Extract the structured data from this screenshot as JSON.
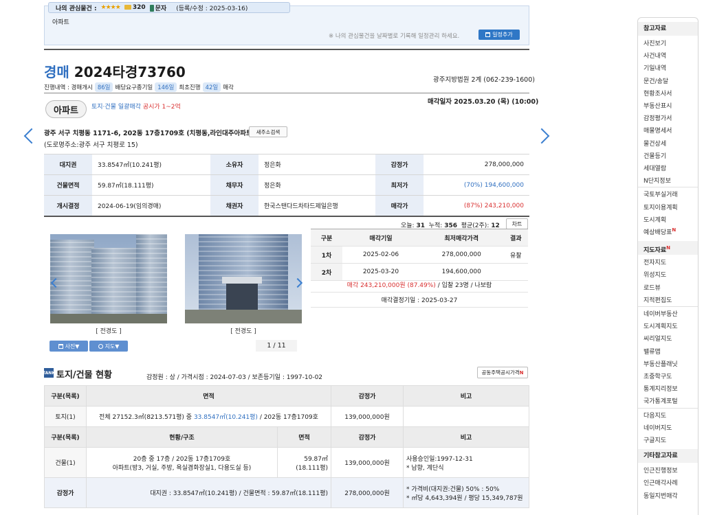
{
  "interest": {
    "label": "나의 관심물건 :",
    "stars": "★★★★",
    "count": "320",
    "sms": "문자",
    "registered": "(등록/수정 : 2025-03-16)",
    "type": "아파트",
    "note": "※ 나의 관심물건을 날짜별로 기록해 일정관리 하세요.",
    "schedule_btn": "일정추가"
  },
  "case": {
    "kind": "경매",
    "number": "2024타경73760",
    "court": "광주지방법원 2계 (062-239-1600)",
    "progress_label": "진행내역 : 경매개시",
    "progress_days1": "86일",
    "progress_mid": "배당요구종기일",
    "progress_days2": "146일",
    "progress_first": "최초진행",
    "progress_days3": "42일",
    "progress_end": "매각",
    "sale_date": "매각일자 2025.03.20 (목) (10:00)",
    "property_type": "아파트",
    "bundle_prefix": "토지·건물 일괄매각",
    "bundle_red": "공시가 1~2억",
    "address": "광주 서구 치평동 1171-6, 202동 17층1709호 (치평동,라인대주아파트)",
    "addr_search_btn": "새주소검색",
    "road_address": "(도로명주소:광주 서구 치평로 15)"
  },
  "info": {
    "rows": [
      {
        "h1": "대지권",
        "v1": "33.8547㎡(10.241평)",
        "h2": "소유자",
        "v2": "정은화",
        "h3": "감정가",
        "v3": "278,000,000"
      },
      {
        "h1": "건물면적",
        "v1": "59.87㎡(18.111평)",
        "h2": "채무자",
        "v2": "정은화",
        "h3": "최저가",
        "v3": "(70%) 194,600,000"
      },
      {
        "h1": "개시결정",
        "v1": "2024-06-19(임의경매)",
        "h2": "채권자",
        "v2": "한국스탠다드차타드제일은행",
        "h3": "매각가",
        "v3": "(87%) 243,210,000"
      }
    ]
  },
  "stats": {
    "today_label": "오늘:",
    "today": "31",
    "total_label": "누적:",
    "total": "356",
    "avg_label": "평균(2주):",
    "avg": "12",
    "chart_btn": "차트"
  },
  "photos": {
    "caption1": "[ 전경도 ]",
    "caption2": "[ 전경도 ]",
    "photo_btn": "사진▼",
    "map_btn": "지도▼",
    "pager": "1 / 11"
  },
  "rounds": {
    "headers": [
      "구분",
      "매각기일",
      "최저매각가격",
      "결과"
    ],
    "rows": [
      {
        "n": "1차",
        "date": "2025-02-06",
        "price": "278,000,000",
        "result": "유찰"
      },
      {
        "n": "2차",
        "date": "2025-03-20",
        "price": "194,600,000",
        "result": ""
      }
    ],
    "result_red": "매각 243,210,000원 (87.49%)",
    "result_rest": " / 입찰 23명 / 나보람",
    "decision": "매각결정기일 : 2025-03-27"
  },
  "land": {
    "icon": "TANK",
    "title": "토지/건물 현황",
    "meta": "감정원 : 상 / 가격시점 : 2024-07-03 / 보존등기일 : 1997-10-02",
    "house_price_btn": "공동주택공시가격",
    "house_price_sup": "N",
    "headers": [
      "구분(목록)",
      "면적",
      "감정가",
      "비고"
    ],
    "row": {
      "label": "토지(1)",
      "area_pre": "전체 27152.3㎡(8213.571평) 중 ",
      "area_blue": "33.8547㎡(10.241평)",
      "area_post": " / 202동 17층1709호",
      "price": "139,000,000원",
      "note": ""
    }
  },
  "building": {
    "headers": [
      "구분(목록)",
      "현황/구조",
      "면적",
      "감정가",
      "비고"
    ],
    "row": {
      "label": "건물(1)",
      "struct1": "20층 중 17층 / 202동 17층1709호",
      "struct2": "아파트(방3, 거실, 주방, 욕실겸화장실1, 다용도실 등)",
      "area1": "59.87㎡",
      "area2": "(18.111평)",
      "price": "139,000,000원",
      "note1": "사용승인일:1997-12-31",
      "note2": "* 남향, 계단식"
    },
    "appraisal": {
      "label": "감정가",
      "detail": "대지권 : 33.8547㎡(10.241평) / 건물면적 : 59.87㎡(18.111평)",
      "price": "278,000,000원",
      "note1": "* 가격비(대지권:건물) 50% : 50%",
      "note2": "* ㎡당 4,643,394원 / 평당 15,349,787원"
    }
  },
  "sidebar": {
    "ref_title": "참고자료",
    "ref_items": [
      "사진보기",
      "사건내역",
      "기일내역",
      "문건/송달",
      "현황조사서",
      "부동산표시",
      "감정평가서",
      "매물명세서",
      "물건상세",
      "건물등기",
      "세대열람",
      "N단지정보"
    ],
    "ref_items2": [
      "국토부실거래",
      "토지이용계획",
      "도시계획",
      "예상배당표"
    ],
    "ref_new_mark": "N",
    "map_title": "지도자료",
    "map_new_mark": "N",
    "map_items": [
      "전자지도",
      "위성지도",
      "로드뷰",
      "지적편집도"
    ],
    "map_items2": [
      "네이버부동산",
      "도시계획지도",
      "씨리얼지도",
      "밸류맵",
      "부동산플래닛",
      "초중학구도",
      "통계지리정보",
      "국가통계포털"
    ],
    "map_items3": [
      "다음지도",
      "네이버지도",
      "구글지도"
    ],
    "etc_title": "기타참고자료",
    "etc_items": [
      "인근진행정보",
      "인근매각사례",
      "동일지번매각"
    ]
  }
}
